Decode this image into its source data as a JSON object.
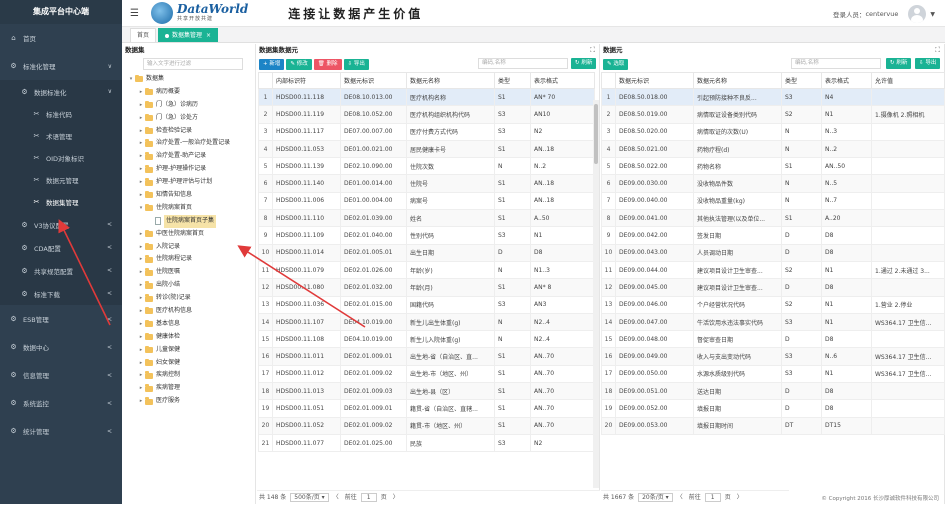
{
  "sidebar": {
    "brand": "集成平台中心端",
    "items": [
      {
        "label": "首页",
        "icon": "home-icon",
        "level": 1,
        "chev": ""
      },
      {
        "label": "标准化管理",
        "icon": "gear-icon",
        "level": 1,
        "chev": "∨"
      },
      {
        "label": "数据标准化",
        "icon": "gear-icon",
        "level": 2,
        "chev": "∨"
      },
      {
        "label": "标准代码",
        "icon": "wrench-icon",
        "level": 3,
        "chev": ""
      },
      {
        "label": "术语管理",
        "icon": "wrench-icon",
        "level": 3,
        "chev": ""
      },
      {
        "label": "OID对象标识",
        "icon": "wrench-icon",
        "level": 3,
        "chev": ""
      },
      {
        "label": "数据元管理",
        "icon": "wrench-icon",
        "level": 3,
        "chev": ""
      },
      {
        "label": "数据集管理",
        "icon": "wrench-icon",
        "level": 3,
        "chev": "",
        "active": true
      },
      {
        "label": "V3协议配置",
        "icon": "gear-icon",
        "level": 2,
        "chev": "<"
      },
      {
        "label": "CDA配置",
        "icon": "gear-icon",
        "level": 2,
        "chev": "<"
      },
      {
        "label": "共享规范配置",
        "icon": "gear-icon",
        "level": 2,
        "chev": "<"
      },
      {
        "label": "标准下载",
        "icon": "gear-icon",
        "level": 2,
        "chev": "<"
      },
      {
        "label": "ESB管理",
        "icon": "gear-icon",
        "level": 1,
        "chev": "<"
      },
      {
        "label": "数据中心",
        "icon": "gear-icon",
        "level": 1,
        "chev": "<"
      },
      {
        "label": "信息管理",
        "icon": "gear-icon",
        "level": 1,
        "chev": "<"
      },
      {
        "label": "系统监控",
        "icon": "gear-icon",
        "level": 1,
        "chev": "<"
      },
      {
        "label": "统计管理",
        "icon": "gear-icon",
        "level": 1,
        "chev": "<"
      }
    ]
  },
  "header": {
    "logo_title": "DataWorld",
    "logo_sub": "共享开放共建",
    "slogan": "连接让数据产生价值",
    "user_label": "登录人员：",
    "user_name": "centervue"
  },
  "tabs": [
    {
      "label": "首页",
      "active": false
    },
    {
      "label": "数据集管理",
      "active": true
    }
  ],
  "tree_panel": {
    "title": "数据集",
    "search_placeholder": "输入文字进行过滤",
    "nodes": [
      {
        "label": "数据集",
        "depth": 0,
        "toggle": "▾",
        "type": "folder"
      },
      {
        "label": "病历概要",
        "depth": 1,
        "toggle": "▸",
        "type": "folder"
      },
      {
        "label": "门（急）诊病历",
        "depth": 1,
        "toggle": "▸",
        "type": "folder"
      },
      {
        "label": "门（急）诊处方",
        "depth": 1,
        "toggle": "▸",
        "type": "folder"
      },
      {
        "label": "检查检验记录",
        "depth": 1,
        "toggle": "▸",
        "type": "folder"
      },
      {
        "label": "治疗处置-一般治疗处置记录",
        "depth": 1,
        "toggle": "▸",
        "type": "folder"
      },
      {
        "label": "治疗处置-助产记录",
        "depth": 1,
        "toggle": "▸",
        "type": "folder"
      },
      {
        "label": "护理-护理操作记录",
        "depth": 1,
        "toggle": "▸",
        "type": "folder"
      },
      {
        "label": "护理-护理评估与计划",
        "depth": 1,
        "toggle": "▸",
        "type": "folder"
      },
      {
        "label": "知情告知信息",
        "depth": 1,
        "toggle": "▸",
        "type": "folder"
      },
      {
        "label": "住院病案首页",
        "depth": 1,
        "toggle": "▾",
        "type": "folder"
      },
      {
        "label": "住院病案首页子集",
        "depth": 2,
        "toggle": "",
        "type": "doc",
        "selected": true
      },
      {
        "label": "中医住院病案首页",
        "depth": 1,
        "toggle": "▸",
        "type": "folder"
      },
      {
        "label": "入院记录",
        "depth": 1,
        "toggle": "▸",
        "type": "folder"
      },
      {
        "label": "住院病程记录",
        "depth": 1,
        "toggle": "▸",
        "type": "folder"
      },
      {
        "label": "住院医嘱",
        "depth": 1,
        "toggle": "▸",
        "type": "folder"
      },
      {
        "label": "出院小结",
        "depth": 1,
        "toggle": "▸",
        "type": "folder"
      },
      {
        "label": "转诊(院)记录",
        "depth": 1,
        "toggle": "▸",
        "type": "folder"
      },
      {
        "label": "医疗机构信息",
        "depth": 1,
        "toggle": "▸",
        "type": "folder"
      },
      {
        "label": "基本信息",
        "depth": 1,
        "toggle": "▸",
        "type": "folder"
      },
      {
        "label": "健康体检",
        "depth": 1,
        "toggle": "▸",
        "type": "folder"
      },
      {
        "label": "儿童保健",
        "depth": 1,
        "toggle": "▸",
        "type": "folder"
      },
      {
        "label": "妇女保健",
        "depth": 1,
        "toggle": "▸",
        "type": "folder"
      },
      {
        "label": "疾病控制",
        "depth": 1,
        "toggle": "▸",
        "type": "folder"
      },
      {
        "label": "疾病管理",
        "depth": 1,
        "toggle": "▸",
        "type": "folder"
      },
      {
        "label": "医疗服务",
        "depth": 1,
        "toggle": "▸",
        "type": "folder"
      }
    ]
  },
  "mid_panel": {
    "title": "数据集数据元",
    "buttons": {
      "add": "新增",
      "edit": "修改",
      "delete": "删除",
      "export": "导出"
    },
    "search_placeholder": "编码,名称",
    "refresh": "刷新",
    "columns": [
      "",
      "内部标识符",
      "数据元标识",
      "数据元名称",
      "类型",
      "表示格式"
    ],
    "rows": [
      [
        "1",
        "HDSD00.11.118",
        "DE08.10.013.00",
        "医疗机构名称",
        "S1",
        "AN* 70"
      ],
      [
        "2",
        "HDSD00.11.119",
        "DE08.10.052.00",
        "医疗机构组织机构代码",
        "S3",
        "AN10"
      ],
      [
        "3",
        "HDSD00.11.117",
        "DE07.00.007.00",
        "医疗付费方式代码",
        "S3",
        "N2"
      ],
      [
        "4",
        "HDSD00.11.053",
        "DE01.00.021.00",
        "居民健康卡号",
        "S1",
        "AN..18"
      ],
      [
        "5",
        "HDSD00.11.139",
        "DE02.10.090.00",
        "住院次数",
        "N",
        "N..2"
      ],
      [
        "6",
        "HDSD00.11.140",
        "DE01.00.014.00",
        "住院号",
        "S1",
        "AN..18"
      ],
      [
        "7",
        "HDSD00.11.006",
        "DE01.00.004.00",
        "病案号",
        "S1",
        "AN..18"
      ],
      [
        "8",
        "HDSD00.11.110",
        "DE02.01.039.00",
        "姓名",
        "S1",
        "A..50"
      ],
      [
        "9",
        "HDSD00.11.109",
        "DE02.01.040.00",
        "性别代码",
        "S3",
        "N1"
      ],
      [
        "10",
        "HDSD00.11.014",
        "DE02.01.005.01",
        "出生日期",
        "D",
        "D8"
      ],
      [
        "11",
        "HDSD00.11.079",
        "DE02.01.026.00",
        "年龄(岁)",
        "N",
        "N1..3"
      ],
      [
        "12",
        "HDSD00.11.080",
        "DE02.01.032.00",
        "年龄(月)",
        "S1",
        "AN* 8"
      ],
      [
        "13",
        "HDSD00.11.036",
        "DE02.01.015.00",
        "国籍代码",
        "S3",
        "AN3"
      ],
      [
        "14",
        "HDSD00.11.107",
        "DE04.10.019.00",
        "新生儿出生体重(g)",
        "N",
        "N2..4"
      ],
      [
        "15",
        "HDSD00.11.108",
        "DE04.10.019.00",
        "新生儿入院体重(g)",
        "N",
        "N2..4"
      ],
      [
        "16",
        "HDSD00.11.011",
        "DE02.01.009.01",
        "出生地-省（自治区、直...",
        "S1",
        "AN..70"
      ],
      [
        "17",
        "HDSD00.11.012",
        "DE02.01.009.02",
        "出生地-市（地区、州）",
        "S1",
        "AN..70"
      ],
      [
        "18",
        "HDSD00.11.013",
        "DE02.01.009.03",
        "出生地-县（区）",
        "S1",
        "AN..70"
      ],
      [
        "19",
        "HDSD00.11.051",
        "DE02.01.009.01",
        "籍贯-省（自治区、直辖...",
        "S1",
        "AN..70"
      ],
      [
        "20",
        "HDSD00.11.052",
        "DE02.01.009.02",
        "籍贯-市（地区、州）",
        "S1",
        "AN..70"
      ],
      [
        "21",
        "HDSD00.11.077",
        "DE02.01.025.00",
        "民族",
        "S3",
        "N2"
      ]
    ],
    "footer": {
      "total": "共 148 条",
      "per_page": "500条/页",
      "prev": "〈",
      "page_label": "前往",
      "page": "1",
      "page_unit": "页",
      "next": "〉"
    }
  },
  "right_panel": {
    "title": "数据元",
    "buttons": {
      "select": "选取"
    },
    "search_placeholder": "编码,名称",
    "refresh": "刷新",
    "export": "导出",
    "columns": [
      "",
      "数据元标识",
      "数据元名称",
      "类型",
      "表示格式",
      "允许值"
    ],
    "rows": [
      [
        "1",
        "DE08.50.018.00",
        "引起预防接种不良反...",
        "S3",
        "N4",
        ""
      ],
      [
        "2",
        "DE08.50.019.00",
        "病情取证设备类别代码",
        "S2",
        "N1",
        "1.摄像机 2.照相机"
      ],
      [
        "3",
        "DE08.50.020.00",
        "病情取证的次数(U)",
        "N",
        "N..3",
        ""
      ],
      [
        "4",
        "DE08.50.021.00",
        "药物疗程(d)",
        "N",
        "N..2",
        ""
      ],
      [
        "5",
        "DE08.50.022.00",
        "药物名称",
        "S1",
        "AN..50",
        ""
      ],
      [
        "6",
        "DE09.00.030.00",
        "没收物品件数",
        "N",
        "N..5",
        ""
      ],
      [
        "7",
        "DE09.00.040.00",
        "没收物品重量(kg)",
        "N",
        "N..7",
        ""
      ],
      [
        "8",
        "DE09.00.041.00",
        "其他执法管理(以及单位...",
        "S1",
        "A..20",
        ""
      ],
      [
        "9",
        "DE09.00.042.00",
        "签发日期",
        "D",
        "D8",
        ""
      ],
      [
        "10",
        "DE09.00.043.00",
        "人员调动日期",
        "D",
        "D8",
        ""
      ],
      [
        "11",
        "DE09.00.044.00",
        "建议项目设计卫生审查...",
        "S2",
        "N1",
        "1.通过 2.未通过 3..."
      ],
      [
        "12",
        "DE09.00.045.00",
        "建议项目设计卫生审查...",
        "D",
        "D8",
        ""
      ],
      [
        "13",
        "DE09.00.046.00",
        "个户经营状况代码",
        "S2",
        "N1",
        "1.营业 2.停业"
      ],
      [
        "14",
        "DE09.00.047.00",
        "牛活饮用水违法事实代码",
        "S3",
        "N1",
        "WS364.17 卫生信..."
      ],
      [
        "15",
        "DE09.00.048.00",
        "督促审查日期",
        "D",
        "D8",
        ""
      ],
      [
        "16",
        "DE09.00.049.00",
        "收入与支出变动代码",
        "S3",
        "N..6",
        "WS364.17 卫生信..."
      ],
      [
        "17",
        "DE09.00.050.00",
        "水源水质级别代码",
        "S3",
        "N1",
        "WS364.17 卫生信..."
      ],
      [
        "18",
        "DE09.00.051.00",
        "送达日期",
        "D",
        "D8",
        ""
      ],
      [
        "19",
        "DE09.00.052.00",
        "填报日期",
        "D",
        "D8",
        ""
      ],
      [
        "20",
        "DE09.00.053.00",
        "填报日期时间",
        "DT",
        "DT15",
        ""
      ]
    ],
    "footer": {
      "total": "共 1667 条",
      "per_page": "20条/页",
      "prev": "〈",
      "page_label": "前往",
      "page": "1",
      "page_unit": "页",
      "next": "〉"
    }
  },
  "copyright": "© Copyright 2016 长沙厚诚软件科技有限公司",
  "colors": {
    "sidebar": "#2f4050",
    "accent_green": "#1ab394",
    "accent_blue": "#1c84c6",
    "accent_red": "#ed5565",
    "arrow_red": "#e03a3a"
  }
}
